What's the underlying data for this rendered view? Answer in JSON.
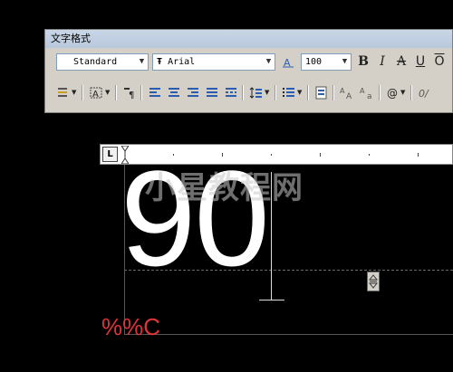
{
  "toolbar": {
    "title": "文字格式",
    "style_value": "Standard",
    "font_prefix": "Ŧ",
    "font_value": "Arial",
    "height_value": "100",
    "bold_label": "B",
    "italic_label": "I",
    "strike_label": "A",
    "underline_label": "U",
    "overline_label": "O"
  },
  "editor": {
    "text": "90",
    "watermark": "小星教程网",
    "code_text": "%%C"
  },
  "ruler": {
    "corner_label": "L"
  },
  "colors": {
    "code_text": "#e0333a",
    "background": "#000000"
  }
}
